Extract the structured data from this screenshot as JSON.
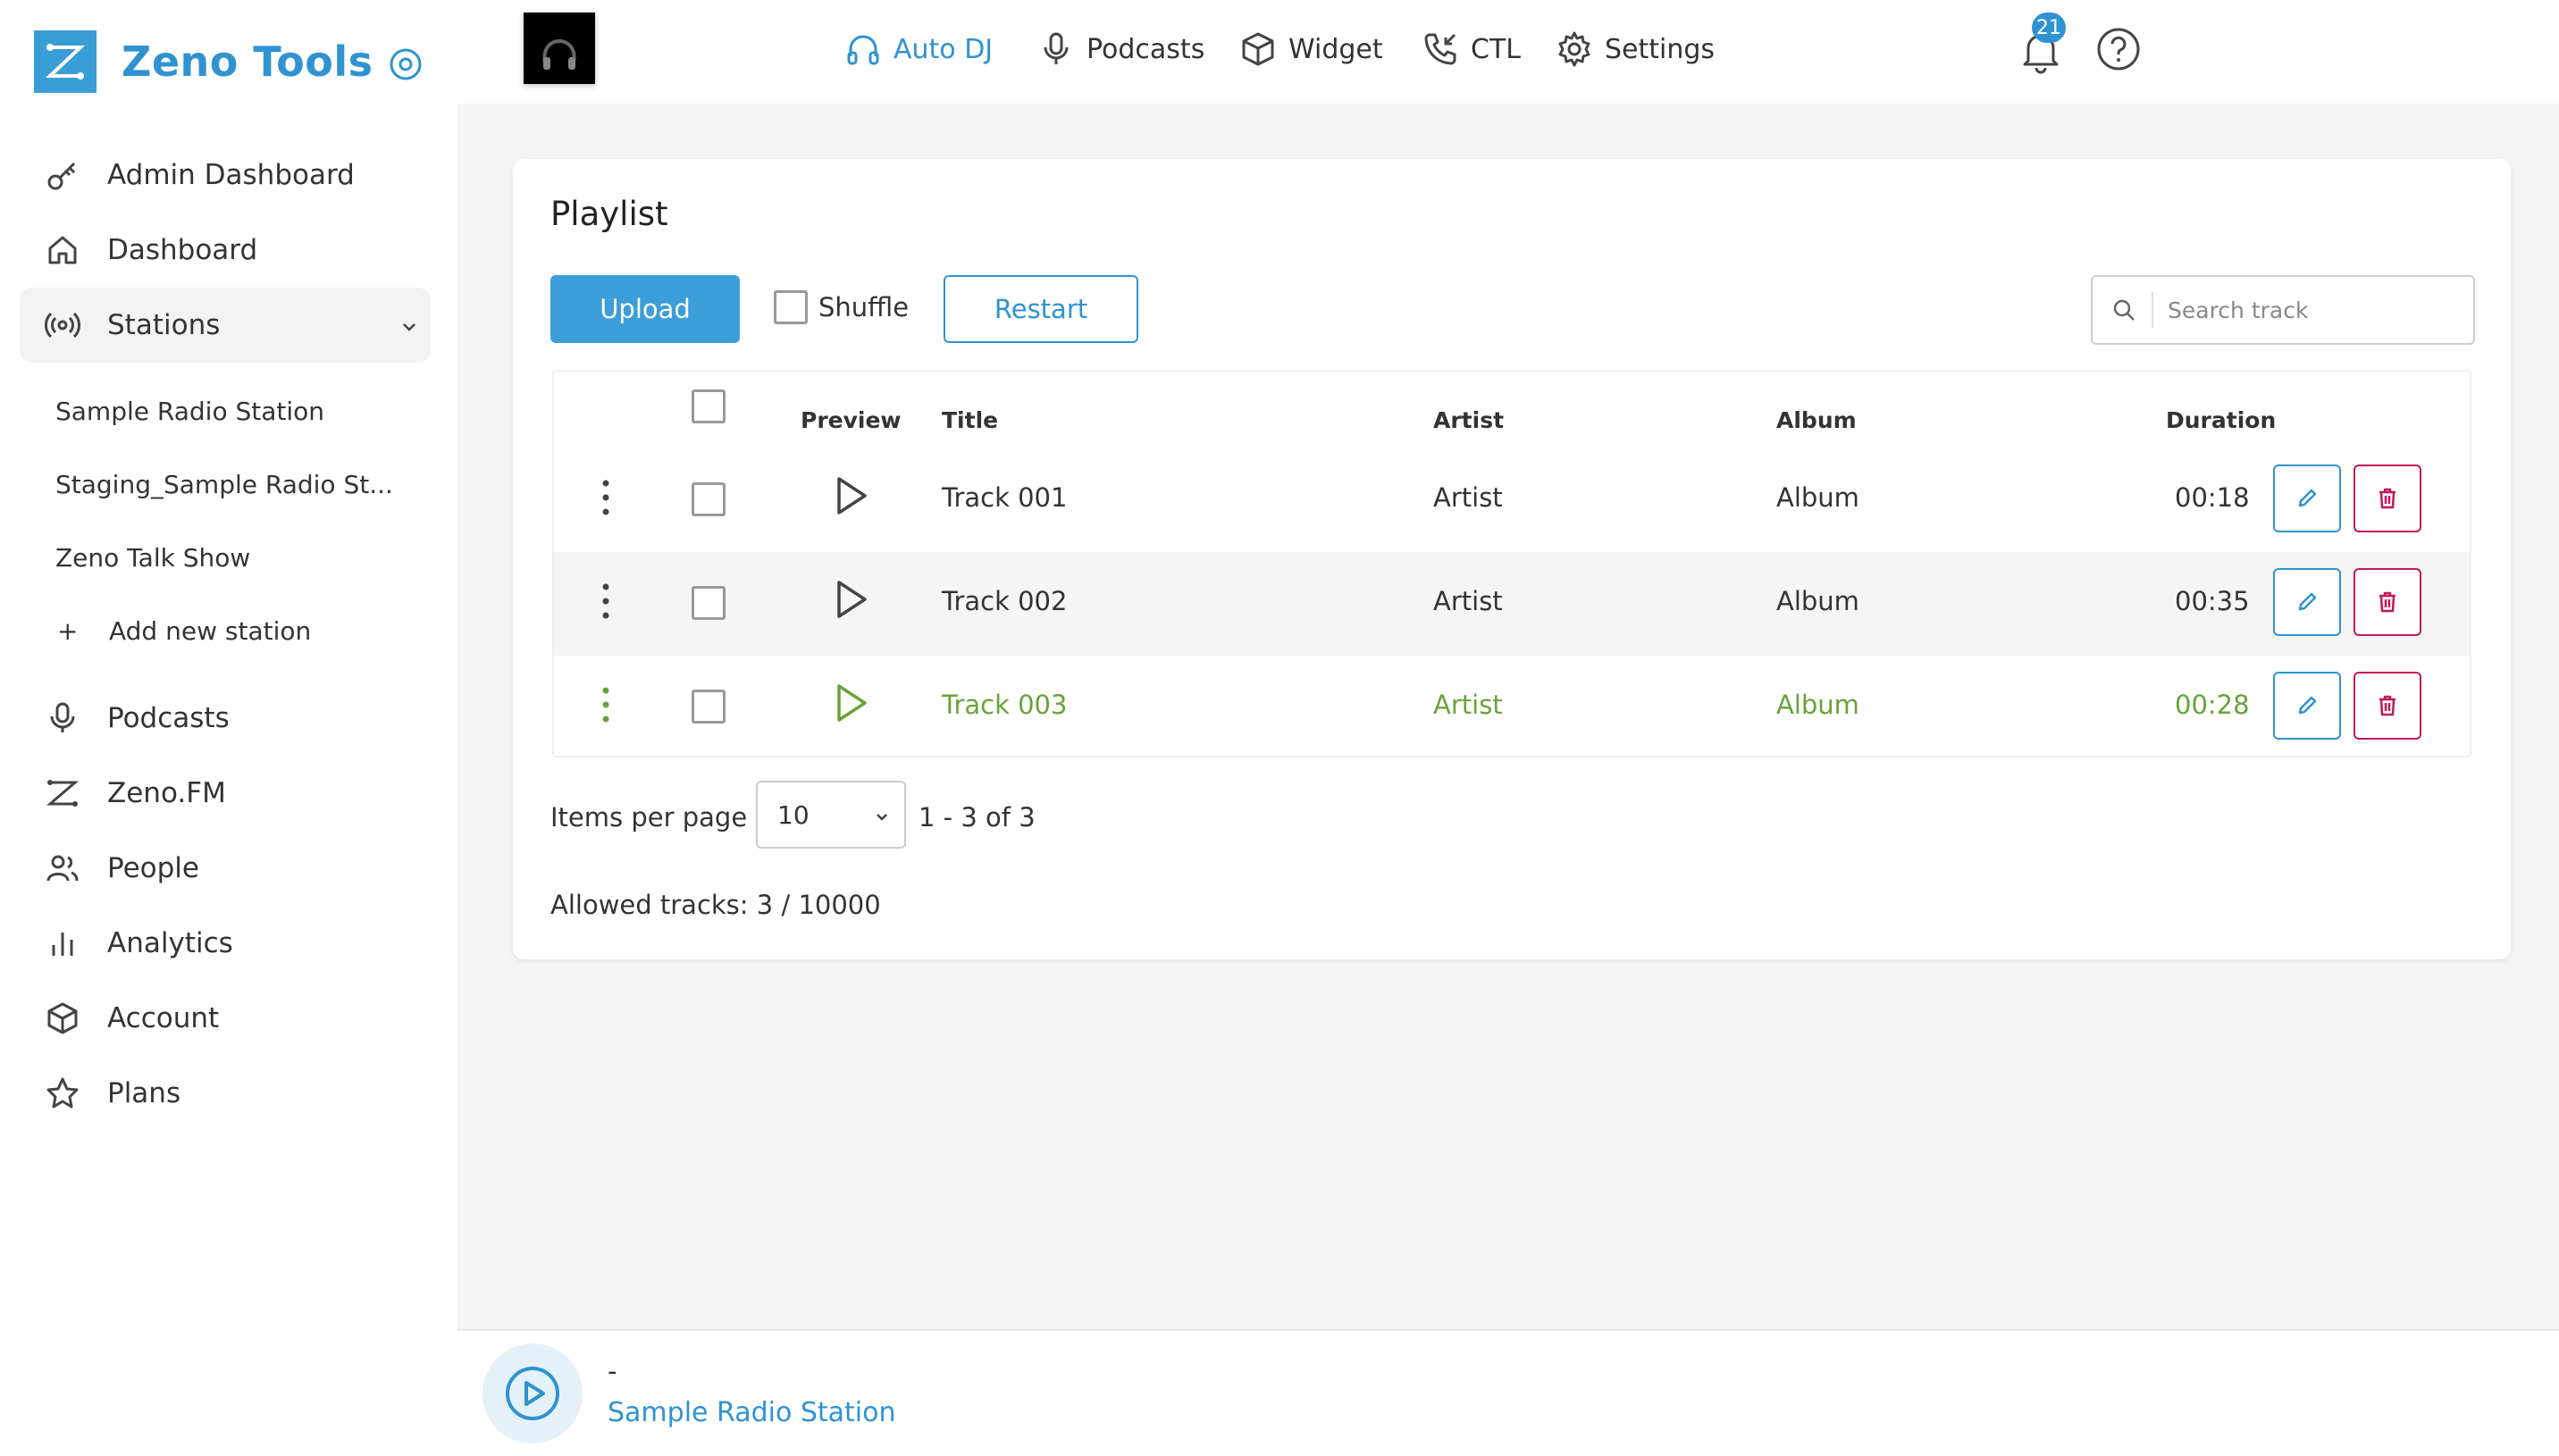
{
  "app": {
    "name": "Zeno Tools"
  },
  "colors": {
    "accent": "#2f93d1",
    "playing": "#6aa23a",
    "danger": "#c2185b"
  },
  "sidebar": {
    "items": [
      {
        "label": "Admin Dashboard",
        "icon": "key-icon"
      },
      {
        "label": "Dashboard",
        "icon": "home-icon"
      },
      {
        "label": "Stations",
        "icon": "broadcast-icon"
      },
      {
        "label": "Podcasts",
        "icon": "microphone-icon"
      },
      {
        "label": "Zeno.FM",
        "icon": "zeno-logo-icon"
      },
      {
        "label": "People",
        "icon": "people-icon"
      },
      {
        "label": "Analytics",
        "icon": "bar-chart-icon"
      },
      {
        "label": "Account",
        "icon": "cube-icon"
      },
      {
        "label": "Plans",
        "icon": "star-icon"
      }
    ],
    "stations": [
      "Sample Radio Station",
      "Staging_Sample Radio St...",
      "Zeno Talk Show"
    ],
    "add_station": {
      "plus": "+",
      "label": "Add new station"
    }
  },
  "topnav": {
    "items": [
      {
        "label": "Auto DJ",
        "icon": "headphones-icon",
        "active": true
      },
      {
        "label": "Podcasts",
        "icon": "microphone-icon"
      },
      {
        "label": "Widget",
        "icon": "cube-icon"
      },
      {
        "label": "CTL",
        "icon": "phone-incoming-icon"
      },
      {
        "label": "Settings",
        "icon": "gear-icon"
      }
    ],
    "notification_count": "21"
  },
  "playlist": {
    "title": "Playlist",
    "upload_label": "Upload",
    "shuffle_label": "Shuffle",
    "restart_label": "Restart",
    "search_placeholder": "Search track",
    "headers": {
      "preview": "Preview",
      "title": "Title",
      "artist": "Artist",
      "album": "Album",
      "duration": "Duration"
    },
    "tracks": [
      {
        "title": "Track 001",
        "artist": "Artist",
        "album": "Album",
        "duration": "00:18"
      },
      {
        "title": "Track 002",
        "artist": "Artist",
        "album": "Album",
        "duration": "00:35"
      },
      {
        "title": "Track 003",
        "artist": "Artist",
        "album": "Album",
        "duration": "00:28",
        "playing": true
      }
    ],
    "items_per_page_label": "Items per page",
    "items_per_page": "10",
    "range": "1 - 3 of 3",
    "allowed": "Allowed tracks: 3 / 10000"
  },
  "player": {
    "track": "-",
    "station": "Sample Radio Station"
  }
}
